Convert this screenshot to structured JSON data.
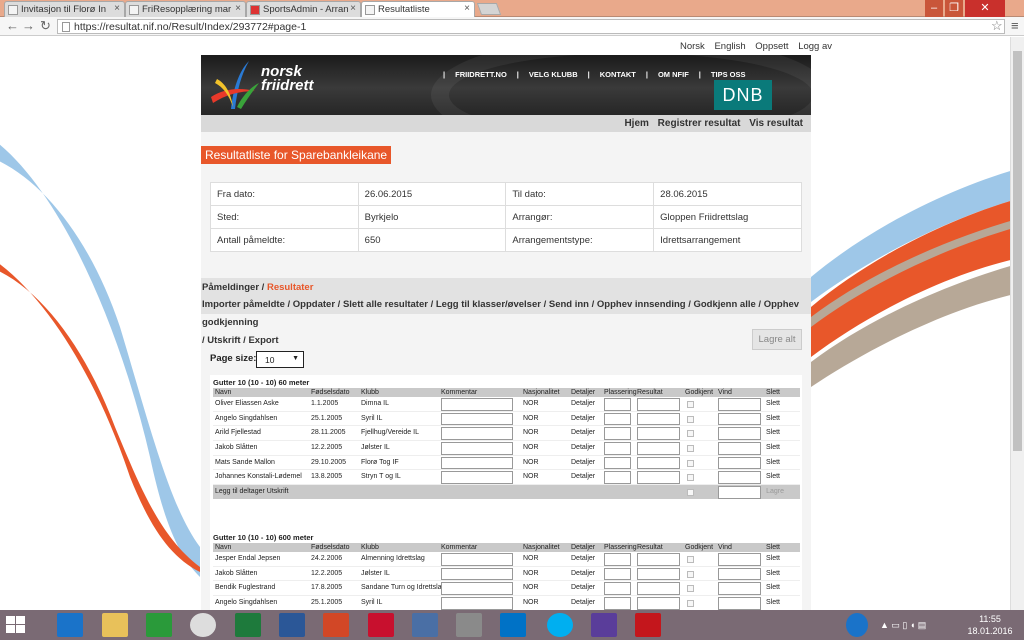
{
  "browser": {
    "tabs": [
      {
        "label": "Invitasjon til Florø In"
      },
      {
        "label": "FriResopplæring mar"
      },
      {
        "label": "SportsAdmin - Arran"
      },
      {
        "label": "Resultatliste"
      }
    ],
    "url": "https://resultat.nif.no/Result/Index/293772#page-1"
  },
  "header": {
    "top_links": [
      "Norsk",
      "English",
      "Oppsett",
      "Logg av"
    ],
    "logo_line1": "norsk",
    "logo_line2": "friidrett",
    "banner_nav": [
      "FRIIDRETT.NO",
      "VELG KLUBB",
      "KONTAKT",
      "OM NFIF",
      "TIPS OSS"
    ],
    "sponsor": "DNB",
    "subnav": [
      "Hjem",
      "Registrer resultat",
      "Vis resultat"
    ]
  },
  "page": {
    "title": "Resultatliste for Sparebankleikane",
    "info": [
      [
        "Fra dato:",
        "26.06.2015",
        "Til dato:",
        "28.06.2015"
      ],
      [
        "Sted:",
        "Byrkjelo",
        "Arrangør:",
        "Gloppen Friidrettslag"
      ],
      [
        "Antall påmeldte:",
        "650",
        "Arrangementstype:",
        "Idrettsarrangement"
      ]
    ],
    "pmenu_a": "Påmeldinger",
    "pmenu_sep": " / ",
    "pmenu_b": "Resultater",
    "actions_line1": "Importer påmeldte / Oppdater / Slett alle resultater / Legg til klasser/øvelser / Send inn / Opphev innsending / Godkjenn alle / Opphev godkjenning",
    "actions_line2": "/ Utskrift / Export",
    "lagre_alt": "Lagre alt",
    "page_size_label": "Page size:",
    "page_size_value": "10"
  },
  "columns": [
    "Navn",
    "Fødselsdato",
    "Klubb",
    "Kommentar",
    "Nasjonalitet",
    "Detaljer",
    "Plassering",
    "Resultat",
    "Godkjent",
    "Vind",
    "Slett"
  ],
  "groups": [
    {
      "title": "Gutter 10 (10 - 10) 60 meter",
      "rows": [
        [
          "Oliver Eliassen Aske",
          "1.1.2005",
          "Dimna IL",
          "NOR",
          "Detaljer",
          "Slett"
        ],
        [
          "Angelo Singdahlsen",
          "25.1.2005",
          "Syril IL",
          "NOR",
          "Detaljer",
          "Slett"
        ],
        [
          "Arild Fjellestad",
          "28.11.2005",
          "Fjellhug/Vereide IL",
          "NOR",
          "Detaljer",
          "Slett"
        ],
        [
          "Jakob Slåtten",
          "12.2.2005",
          "Jølster IL",
          "NOR",
          "Detaljer",
          "Slett"
        ],
        [
          "Mats Sande Mallon",
          "29.10.2005",
          "Florø Tog IF",
          "NOR",
          "Detaljer",
          "Slett"
        ],
        [
          "Johannes Konstali-Lødemel",
          "13.8.2005",
          "Stryn T og IL",
          "NOR",
          "Detaljer",
          "Slett"
        ]
      ]
    },
    {
      "title": "Gutter 10 (10 - 10) 600 meter",
      "rows": [
        [
          "Jesper Endal Jepsen",
          "24.2.2006",
          "Almenning Idrettslag",
          "NOR",
          "Detaljer",
          "Slett"
        ],
        [
          "Jakob Slåtten",
          "12.2.2005",
          "Jølster IL",
          "NOR",
          "Detaljer",
          "Slett"
        ],
        [
          "Bendik Fuglestrand",
          "17.8.2005",
          "Sandane Turn og Idrettslag",
          "NOR",
          "Detaljer",
          "Slett"
        ],
        [
          "Angelo Singdahlsen",
          "25.1.2005",
          "Syril IL",
          "NOR",
          "Detaljer",
          "Slett"
        ]
      ]
    }
  ],
  "footer_links": [
    "Legg til deltager",
    "Utskrift"
  ],
  "footer_save": "Lagre",
  "taskbar": {
    "time": "11:55",
    "date": "18.01.2016"
  }
}
